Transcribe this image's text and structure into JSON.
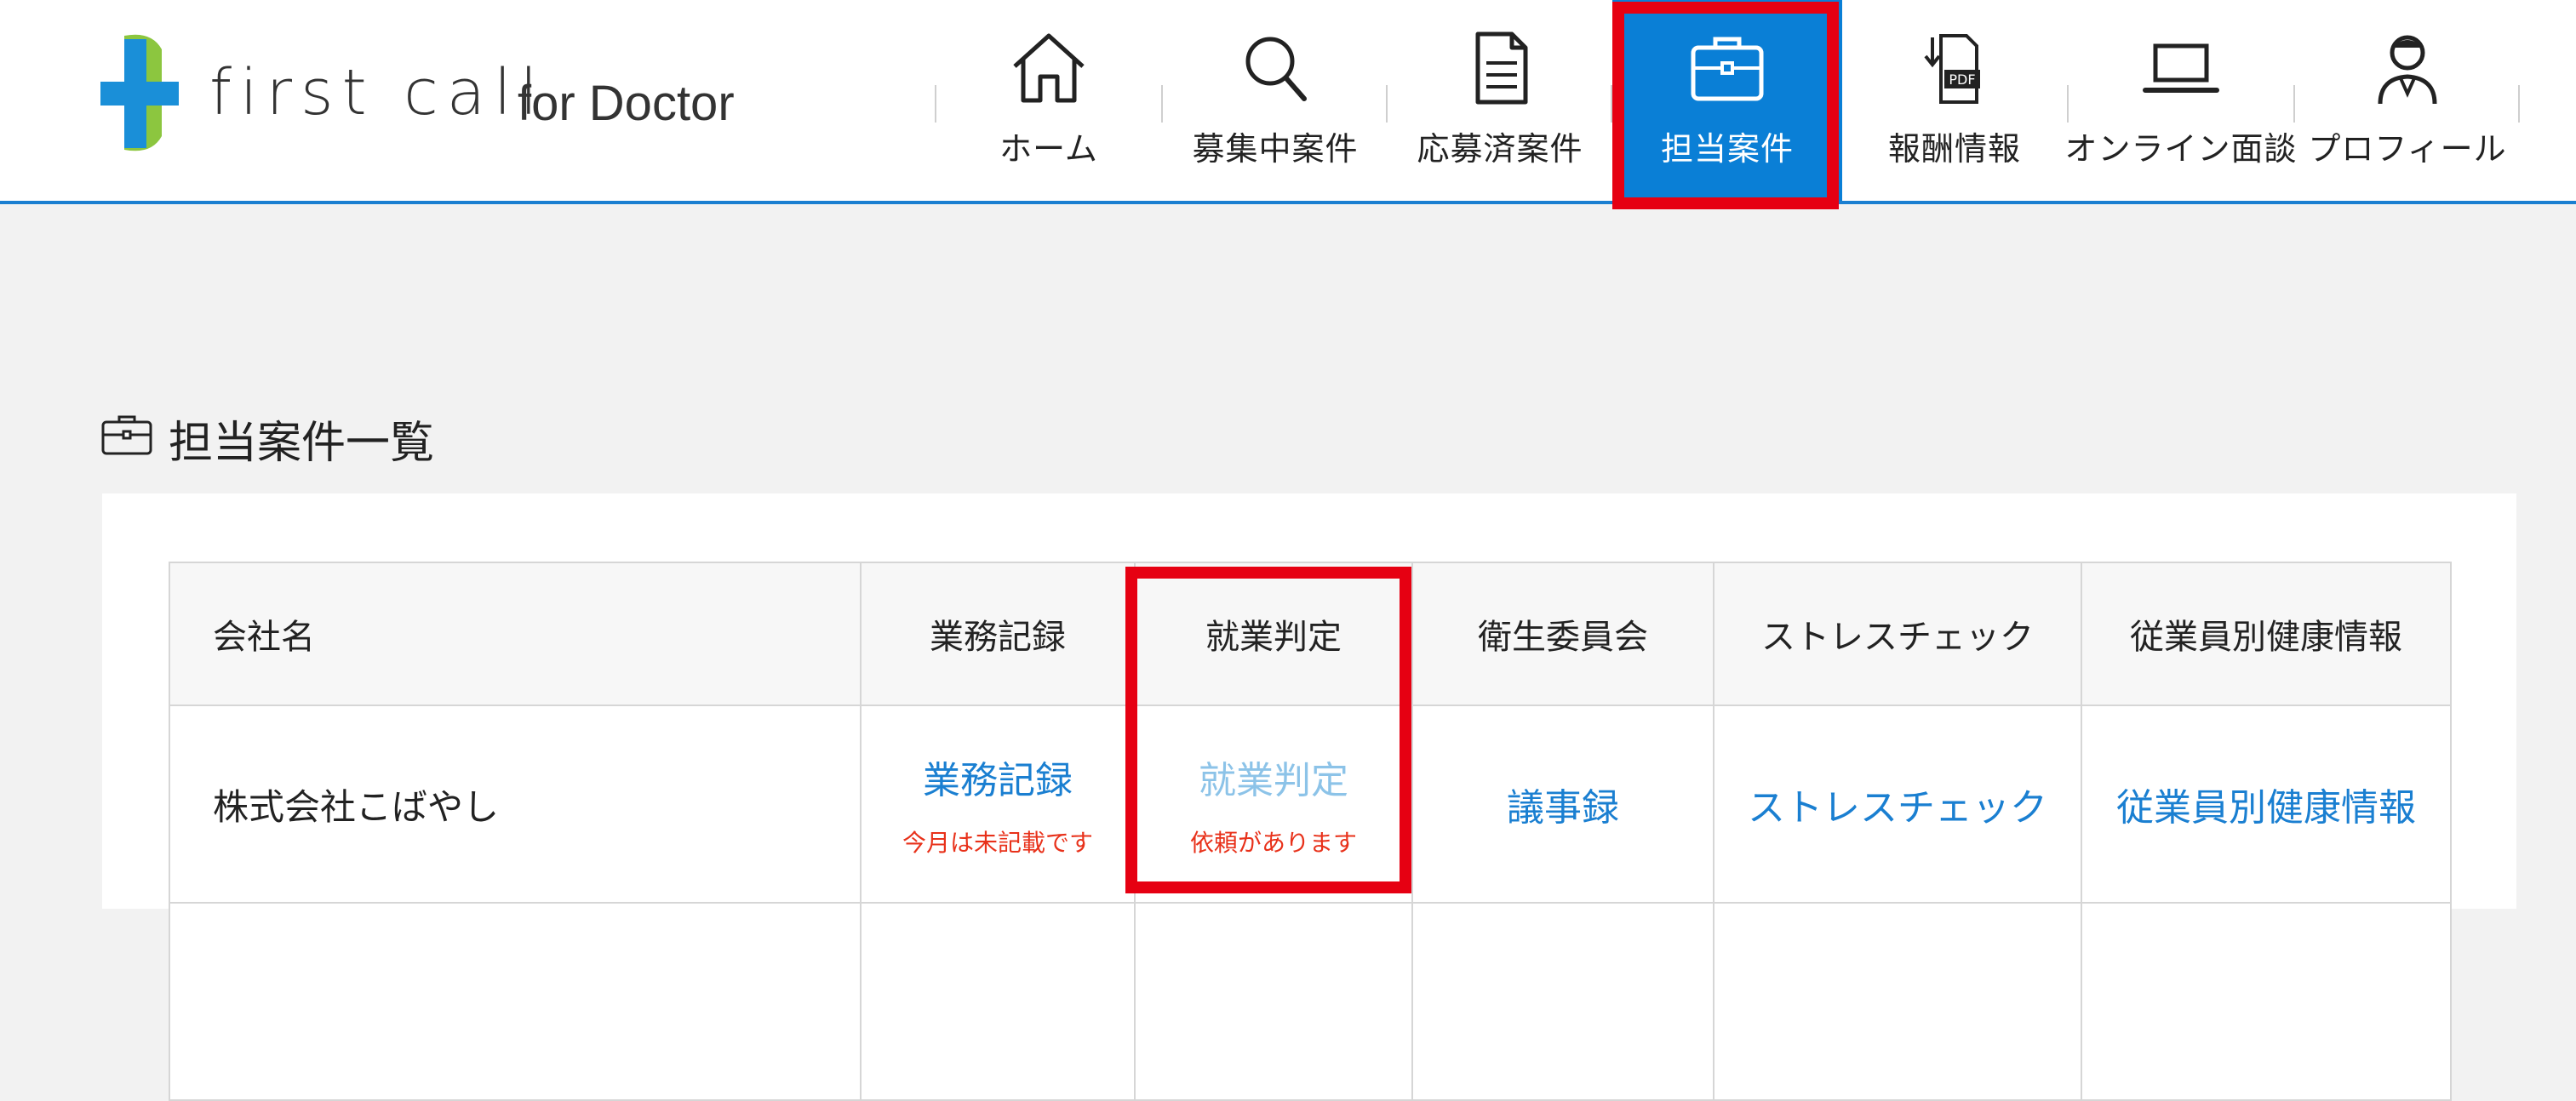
{
  "logo": {
    "main": "first call",
    "sub": "for Doctor"
  },
  "nav": {
    "items": [
      {
        "label": "ホーム",
        "icon": "home-icon"
      },
      {
        "label": "募集中案件",
        "icon": "search-icon"
      },
      {
        "label": "応募済案件",
        "icon": "document-icon"
      },
      {
        "label": "担当案件",
        "icon": "briefcase-icon",
        "active": true
      },
      {
        "label": "報酬情報",
        "icon": "pdf-download-icon"
      },
      {
        "label": "オンライン面談",
        "icon": "laptop-icon"
      },
      {
        "label": "プロフィール",
        "icon": "doctor-icon"
      }
    ]
  },
  "page": {
    "title": "担当案件一覧"
  },
  "table": {
    "headers": [
      "会社名",
      "業務記録",
      "就業判定",
      "衛生委員会",
      "ストレスチェック",
      "従業員別健康情報"
    ],
    "rows": [
      {
        "company": "株式会社こばやし",
        "work_record": {
          "label": "業務記録",
          "note": "今月は未記載です"
        },
        "employment_judgment": {
          "label": "就業判定",
          "note": "依頼があります"
        },
        "committee": {
          "label": "議事録"
        },
        "stress_check": {
          "label": "ストレスチェック"
        },
        "health_info": {
          "label": "従業員別健康情報"
        }
      }
    ]
  },
  "colors": {
    "accent": "#0a7fd6",
    "link": "#1a7fd1",
    "link_disabled": "#8cc3e8",
    "warning_text": "#e8311a",
    "highlight": "#e60012",
    "logo_blue": "#1a8fd8",
    "logo_green": "#8cc63f"
  }
}
